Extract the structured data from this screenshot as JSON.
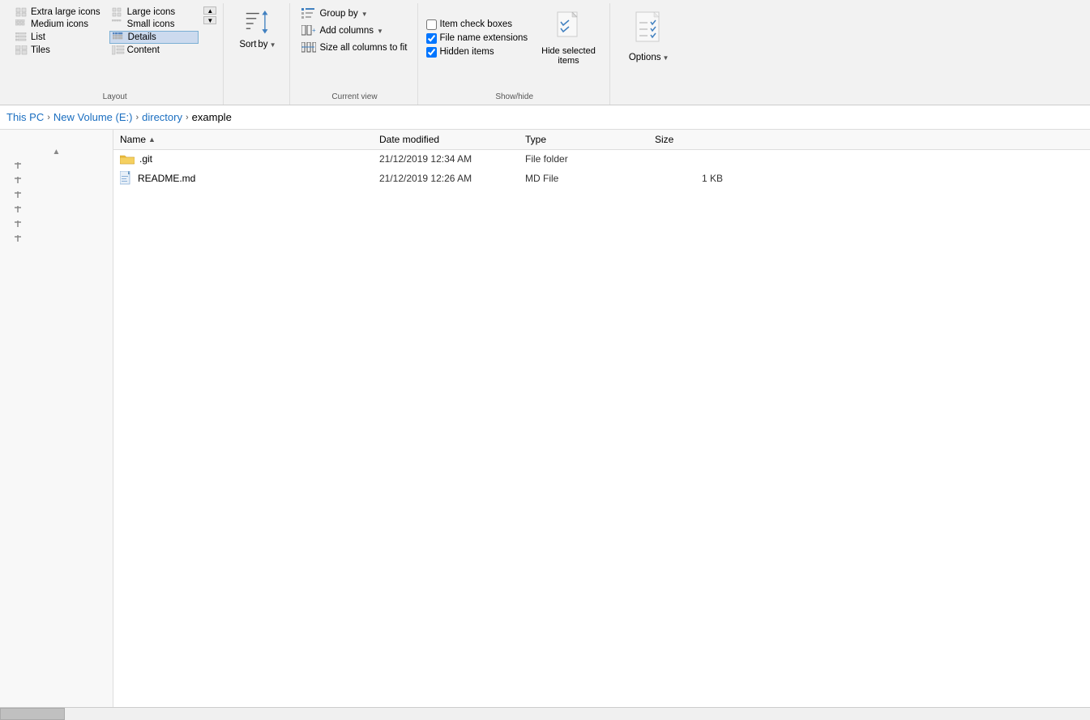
{
  "ribbon": {
    "layout_group_label": "Layout",
    "current_view_label": "Current view",
    "showhide_label": "Show/hide",
    "layout_items": [
      {
        "id": "extra-large-icons",
        "label": "Extra large icons"
      },
      {
        "id": "large-icons",
        "label": "Large icons"
      },
      {
        "id": "medium-icons",
        "label": "Medium icons"
      },
      {
        "id": "small-icons",
        "label": "Small icons"
      },
      {
        "id": "list",
        "label": "List"
      },
      {
        "id": "details",
        "label": "Details",
        "selected": true
      },
      {
        "id": "tiles",
        "label": "Tiles"
      },
      {
        "id": "content",
        "label": "Content"
      }
    ],
    "sort_label": "Sort\nby",
    "sort_by_label": "Sort",
    "sort_by_sub": "by",
    "group_by_label": "Group by",
    "add_columns_label": "Add columns",
    "size_all_label": "Size all columns to fit",
    "item_checkboxes_label": "Item check boxes",
    "file_name_extensions_label": "File name extensions",
    "hidden_items_label": "Hidden items",
    "hide_selected_label": "Hide selected\nitems",
    "options_label": "Options"
  },
  "breadcrumb": {
    "items": [
      "This PC",
      "New Volume (E:)",
      "directory",
      "example"
    ]
  },
  "file_list": {
    "columns": [
      {
        "id": "name",
        "label": "Name",
        "sort": "asc"
      },
      {
        "id": "date",
        "label": "Date modified"
      },
      {
        "id": "type",
        "label": "Type"
      },
      {
        "id": "size",
        "label": "Size"
      }
    ],
    "files": [
      {
        "name": ".git",
        "type_icon": "folder",
        "date": "21/12/2019 12:34 AM",
        "file_type": "File folder",
        "size": ""
      },
      {
        "name": "README.md",
        "type_icon": "md",
        "date": "21/12/2019 12:26 AM",
        "file_type": "MD File",
        "size": "1 KB"
      }
    ]
  },
  "nav_pins": [
    "",
    "",
    "",
    "",
    "",
    ""
  ]
}
